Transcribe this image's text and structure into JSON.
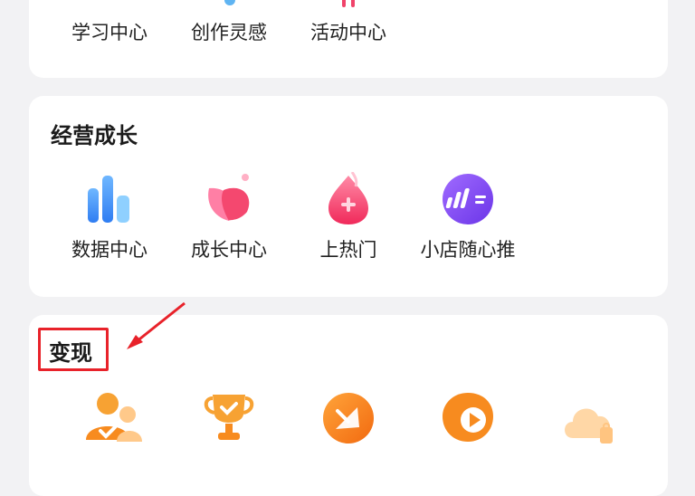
{
  "top_section": {
    "items": [
      {
        "label": "学习中心",
        "icon": "book-icon"
      },
      {
        "label": "创作灵感",
        "icon": "bulb-icon"
      },
      {
        "label": "活动中心",
        "icon": "activity-icon"
      }
    ]
  },
  "business_section": {
    "title": "经营成长",
    "items": [
      {
        "label": "数据中心",
        "icon": "bar-chart-icon"
      },
      {
        "label": "成长中心",
        "icon": "petal-icon"
      },
      {
        "label": "上热门",
        "icon": "flame-plus-icon"
      },
      {
        "label": "小店随心推",
        "icon": "promote-icon"
      }
    ]
  },
  "monetize_section": {
    "title": "变现",
    "items": [
      {
        "label": "",
        "icon": "user-task-icon"
      },
      {
        "label": "",
        "icon": "trophy-icon"
      },
      {
        "label": "",
        "icon": "store-icon"
      },
      {
        "label": "",
        "icon": "play-bubble-icon"
      },
      {
        "label": "",
        "icon": "cloud-plus-icon"
      }
    ]
  },
  "colors": {
    "highlight": "#e8222a",
    "card_bg": "#ffffff",
    "page_bg": "#f2f2f4"
  }
}
